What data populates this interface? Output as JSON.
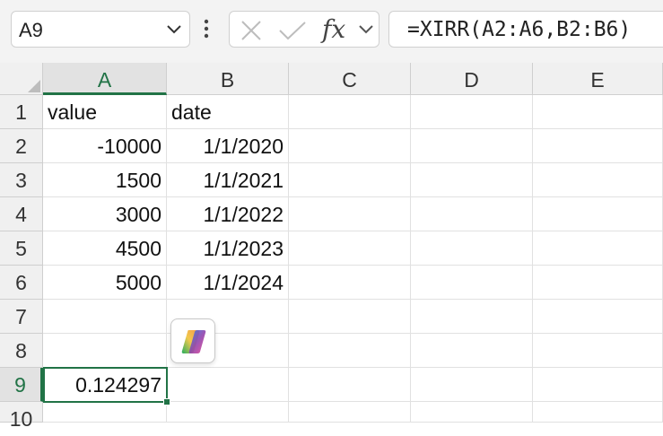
{
  "namebox": {
    "ref": "A9"
  },
  "formula_bar": {
    "formula": "=XIRR(A2:A6,B2:B6)"
  },
  "fx_label": "fx",
  "columns": [
    "A",
    "B",
    "C",
    "D",
    "E"
  ],
  "rows": [
    "1",
    "2",
    "3",
    "4",
    "5",
    "6",
    "7",
    "8",
    "9",
    "10"
  ],
  "cells": {
    "A1": "value",
    "B1": "date",
    "A2": "-10000",
    "B2": "1/1/2020",
    "A3": "1500",
    "B3": "1/1/2021",
    "A4": "3000",
    "B4": "1/1/2022",
    "A5": "4500",
    "B5": "1/1/2023",
    "A6": "5000",
    "B6": "1/1/2024",
    "A9": "0.124297"
  },
  "selection": {
    "cell": "A9",
    "column": "A",
    "row": "9"
  },
  "colors": {
    "accent": "#217346"
  },
  "icons": [
    "chevron-down-icon",
    "more-vertical-icon",
    "cancel-x-icon",
    "enter-check-icon",
    "copilot-icon"
  ]
}
